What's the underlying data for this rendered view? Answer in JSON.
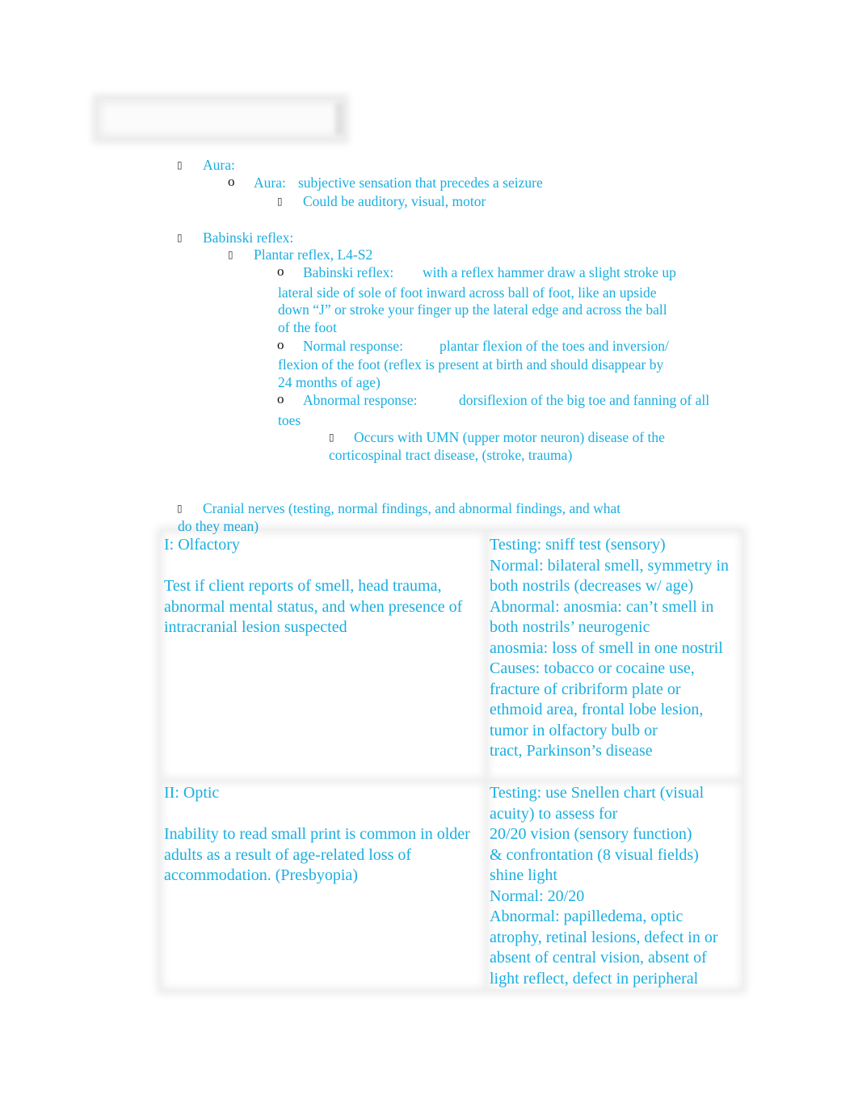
{
  "document": {
    "redacted_header_box": "",
    "sections": [
      {
        "heading": "Aura:",
        "items": [
          {
            "bullet": "o",
            "label": "Aura:",
            "text": "subjective sensation that precedes a seizure",
            "subitems": [
              "Could be auditory, visual, motor"
            ]
          }
        ]
      },
      {
        "heading": "Babinski reflex:",
        "items": [
          {
            "text": "Plantar reflex, L4-S2",
            "subitems": [
              {
                "label": "Babinski reflex:",
                "lines": [
                  "with a reflex hammer draw a slight stroke up",
                  "lateral side of sole of foot inward across ball of foot, like an upside",
                  "down “J” or stroke your finger up the lateral edge and across the ball",
                  "of the foot"
                ]
              },
              {
                "label": "Normal response:",
                "lines": [
                  "plantar flexion of the toes and inversion/",
                  "flexion of the foot (reflex is present at birth and should disappear by",
                  "24 months of age)"
                ]
              },
              {
                "label": "Abnormal response:",
                "lines": [
                  "dorsiflexion of the big toe and fanning of all",
                  "toes"
                ],
                "subitems": [
                  {
                    "lines": [
                      "Occurs with UMN (upper motor neuron) disease of the",
                      "corticospinal tract disease, (stroke, trauma)"
                    ]
                  }
                ]
              }
            ]
          }
        ]
      },
      {
        "heading_lines": [
          "Cranial nerves (testing, normal findings, and abnormal findings, and what",
          "do they mean)"
        ]
      }
    ],
    "cranial_table": {
      "rows": [
        {
          "nerve": "I: Olfactory",
          "description_lines": [
            "Test if client reports of smell, head trauma,",
            "abnormal mental status, and when presence of",
            "intracranial lesion suspected"
          ],
          "findings_lines": [
            "Testing: sniff test (sensory)",
            "Normal: bilateral smell, symmetry in",
            "both nostrils (decreases w/ age)",
            "Abnormal: anosmia: can’t smell in",
            "both nostrils’ neurogenic",
            "anosmia: loss of smell in one nostril",
            "Causes: tobacco or cocaine use,",
            "fracture of cribriform plate or",
            "ethmoid area, frontal lobe lesion,",
            "tumor in olfactory bulb or",
            "tract, Parkinson’s disease"
          ]
        },
        {
          "nerve": "II: Optic",
          "description_lines": [
            "Inability to read small print is common in older",
            "adults as a result of age-related loss of",
            "accommodation. (Presbyopia)"
          ],
          "findings_lines": [
            "Testing: use Snellen chart (visual",
            "acuity) to assess for",
            "20/20 vision (sensory function)",
            "& confrontation (8 visual fields)",
            "shine light",
            "Normal: 20/20",
            "Abnormal: papilledema, optic",
            "atrophy, retinal lesions, defect in or",
            "absent of central vision, absent of",
            "light reflect, defect in peripheral"
          ]
        }
      ]
    },
    "bullets": {
      "square": "▯",
      "circle": "o"
    },
    "colors": {
      "text": "#1aaee0",
      "bullet_glyph": "#333333"
    }
  }
}
